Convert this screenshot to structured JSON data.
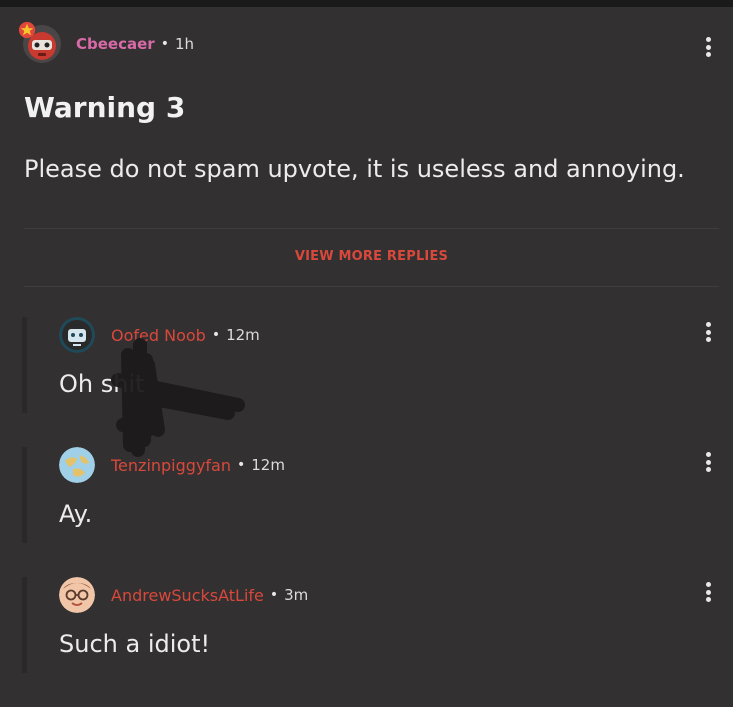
{
  "post": {
    "author": "Cbeecaer",
    "separator": "•",
    "time": "1h",
    "title": "Warning 3",
    "body": "Please do not spam upvote, it is useless and annoying."
  },
  "view_more_label": "VIEW MORE REPLIES",
  "replies": [
    {
      "author": "Oofed Noob",
      "separator": "•",
      "time": "12m",
      "body": "Oh shit"
    },
    {
      "author": "Tenzinpiggyfan",
      "separator": "•",
      "time": "12m",
      "body": "Ay."
    },
    {
      "author": "AndrewSucksAtLife",
      "separator": "•",
      "time": "3m",
      "body": "Such a idiot!"
    }
  ],
  "icons": {
    "post_avatar": "red-robot-avatar-icon",
    "badge": "star-badge-icon",
    "menu": "more-vertical-icon",
    "reply1_avatar": "robot-avatar-icon",
    "reply2_avatar": "globe-avatar-icon",
    "reply3_avatar": "glasses-face-avatar-icon"
  },
  "colors": {
    "background": "#323031",
    "post_author": "#d96aa8",
    "reply_author": "#d9483b",
    "view_more": "#d9483b"
  }
}
